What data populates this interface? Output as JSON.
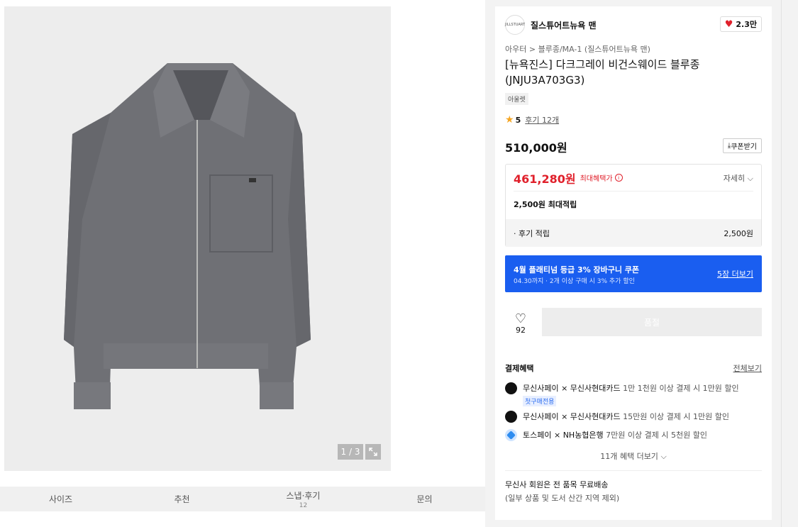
{
  "gallery": {
    "counter": "1 / 3"
  },
  "tabs": [
    {
      "label": "사이즈",
      "sub": ""
    },
    {
      "label": "추천",
      "sub": ""
    },
    {
      "label": "스냅·후기",
      "sub": "12"
    },
    {
      "label": "문의",
      "sub": ""
    }
  ],
  "brand": {
    "logo_text": "JILLSTUART",
    "name": "질스튜어트뉴욕 맨",
    "likes": "2.3만"
  },
  "breadcrumb": {
    "level1": "아우터",
    "sep": ">",
    "level2": "블루종/MA-1 (질스튜어트뉴욕 맨)"
  },
  "product": {
    "title": "[뉴욕진스] 다크그레이 비건스웨이드 블루종 (JNJU3A703G3)",
    "tag": "아울렛",
    "rating": "5",
    "reviews": "후기 12개",
    "price": "510,000원",
    "coupon_label": "쿠폰받기"
  },
  "benefit_box": {
    "sale_price": "461,280원",
    "max_benefit_label": "최대혜택가",
    "detail_label": "자세히",
    "points_max": "2,500원 최대적립",
    "review_points_label": "· 후기 적립",
    "review_points_value": "2,500원"
  },
  "coupon_banner": {
    "title": "4월 플래티넘 등급 3% 장바구니 쿠폰",
    "subtitle": "04.30까지 · 2개 이상 구매 시 3% 추가 할인",
    "more": "5장 더보기"
  },
  "wishlist": {
    "count": "92"
  },
  "buy": {
    "label": "품절"
  },
  "payment": {
    "heading": "결제혜택",
    "view_all": "전체보기",
    "items": [
      {
        "name": "무신사페이 × 무신사현대카드",
        "desc": "1만 1천원 이상 결제 시 1만원 할인",
        "badge": "첫구매전용"
      },
      {
        "name": "무신사페이 × 무신사현대카드",
        "desc": "15만원 이상 결제 시 1만원 할인",
        "badge": ""
      },
      {
        "name": "토스페이 × NH농협은행",
        "desc": "7만원 이상 결제 시 5천원 할인",
        "badge": ""
      }
    ],
    "more": "11개 혜택 더보기"
  },
  "shipping": {
    "line1": "무신사 회원은 전 품목 무료배송",
    "line2": "(일부 상품 및 도서 산간 지역 제외)"
  },
  "colors": {
    "accent_red": "#e0202b",
    "banner_blue": "#1a5ef0",
    "jacket": "#6f7075"
  }
}
